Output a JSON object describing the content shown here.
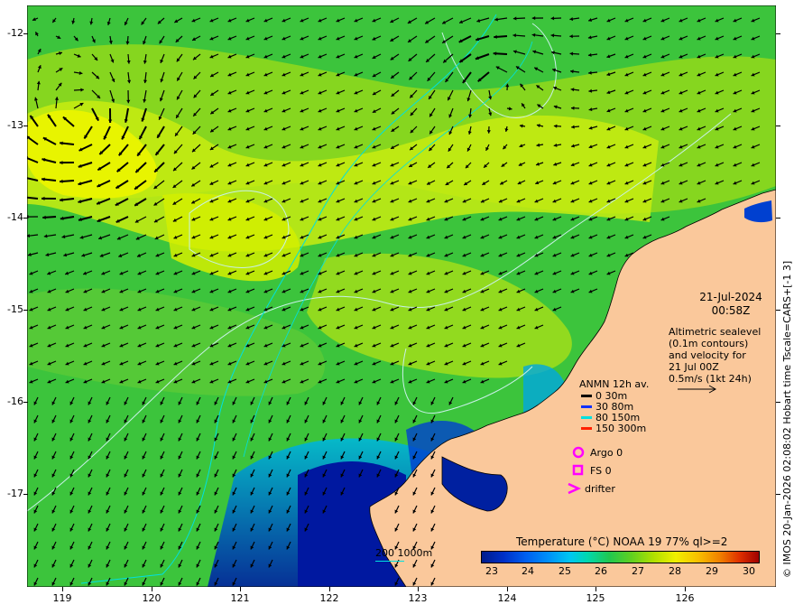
{
  "map": {
    "axes": {
      "y_ticks": [
        "-12",
        "-13",
        "-14",
        "-15",
        "-16",
        "-17"
      ],
      "x_ticks": [
        "119",
        "120",
        "121",
        "122",
        "123",
        "124",
        "125",
        "126"
      ]
    },
    "credit": "© IMOS 20-Jan-2026 02:08:02 Hobart time Tscale=CARS+[-1 3]",
    "date": "21-Jul-2024",
    "time": "00:58Z",
    "altimetry_note": [
      "Altimetric sealevel",
      "(0.1m contours)",
      "and velocity for",
      "21 Jul 00Z",
      "0.5m/s (1kt 24h)"
    ],
    "anmn_legend": {
      "title": "ANMN 12h av.",
      "items": [
        {
          "label": "0 30m",
          "color": "#000000"
        },
        {
          "label": "30 80m",
          "color": "#1030ff"
        },
        {
          "label": "80 150m",
          "color": "#00e0e0"
        },
        {
          "label": "150 300m",
          "color": "#ff2000"
        }
      ]
    },
    "markers": [
      {
        "label": "Argo 0",
        "icon": "circle-icon",
        "color": "#ff00ff"
      },
      {
        "label": "FS 0",
        "icon": "square-icon",
        "color": "#ff00ff"
      },
      {
        "label": "drifter",
        "icon": "chevron-icon",
        "color": "#ff00ff"
      }
    ],
    "bathymetry_legend": {
      "shallow": "200",
      "deep": "1000m",
      "color": "#00e0e0"
    },
    "colorbar": {
      "title": "Temperature (°C) NOAA 19 77% ql>=2",
      "ticks": [
        "23",
        "24",
        "25",
        "26",
        "27",
        "28",
        "29",
        "30"
      ]
    },
    "colors": {
      "land": "#fac89b",
      "sst_main": "#40c840",
      "sst_warm": "#c8f000",
      "sst_cool": "#0030c8"
    }
  }
}
